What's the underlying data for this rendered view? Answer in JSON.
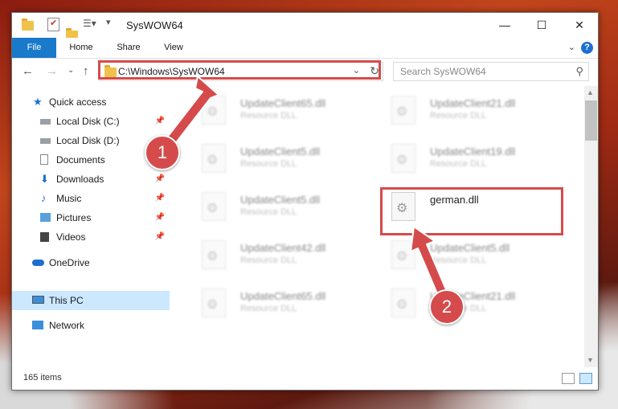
{
  "window": {
    "title": "SysWOW64",
    "controls": {
      "minimize": "—",
      "maximize": "☐",
      "close": "✕"
    }
  },
  "ribbon": {
    "tabs": [
      "File",
      "Home",
      "Share",
      "View"
    ],
    "help": "?"
  },
  "address": {
    "path": "C:\\Windows\\SysWOW64",
    "search_placeholder": "Search SysWOW64"
  },
  "sidebar": {
    "items": [
      {
        "label": "Quick access",
        "icon": "star-icon"
      },
      {
        "label": "Local Disk (C:)",
        "icon": "drive-icon"
      },
      {
        "label": "Local Disk (D:)",
        "icon": "drive-icon"
      },
      {
        "label": "Documents",
        "icon": "documents-icon"
      },
      {
        "label": "Downloads",
        "icon": "download-icon"
      },
      {
        "label": "Music",
        "icon": "music-icon"
      },
      {
        "label": "Pictures",
        "icon": "pictures-icon"
      },
      {
        "label": "Videos",
        "icon": "videos-icon"
      },
      {
        "label": "OneDrive",
        "icon": "cloud-icon"
      },
      {
        "label": "This PC",
        "icon": "computer-icon"
      },
      {
        "label": "Network",
        "icon": "network-icon"
      }
    ]
  },
  "files": [
    {
      "name": "UpdateClient65.dll",
      "type": "Resource DLL"
    },
    {
      "name": "UpdateClient21.dll",
      "type": "Resource DLL"
    },
    {
      "name": "UpdateClient5.dll",
      "type": "Resource DLL"
    },
    {
      "name": "UpdateClient19.dll",
      "type": "Resource DLL"
    },
    {
      "name": "UpdateClient5.dll",
      "type": "Resource DLL"
    },
    {
      "name": "german.dll",
      "type": ""
    },
    {
      "name": "UpdateClient42.dll",
      "type": "Resource DLL"
    },
    {
      "name": "UpdateClient5.dll",
      "type": "Resource DLL"
    },
    {
      "name": "UpdateClient65.dll",
      "type": "Resource DLL"
    },
    {
      "name": "UpdateClient21.dll",
      "type": "Resource DLL"
    }
  ],
  "status": {
    "item_count": "165 items"
  },
  "callouts": [
    "1",
    "2"
  ],
  "colors": {
    "accent": "#1979ca",
    "highlight": "#d54b4b",
    "selection": "#cce8ff"
  }
}
